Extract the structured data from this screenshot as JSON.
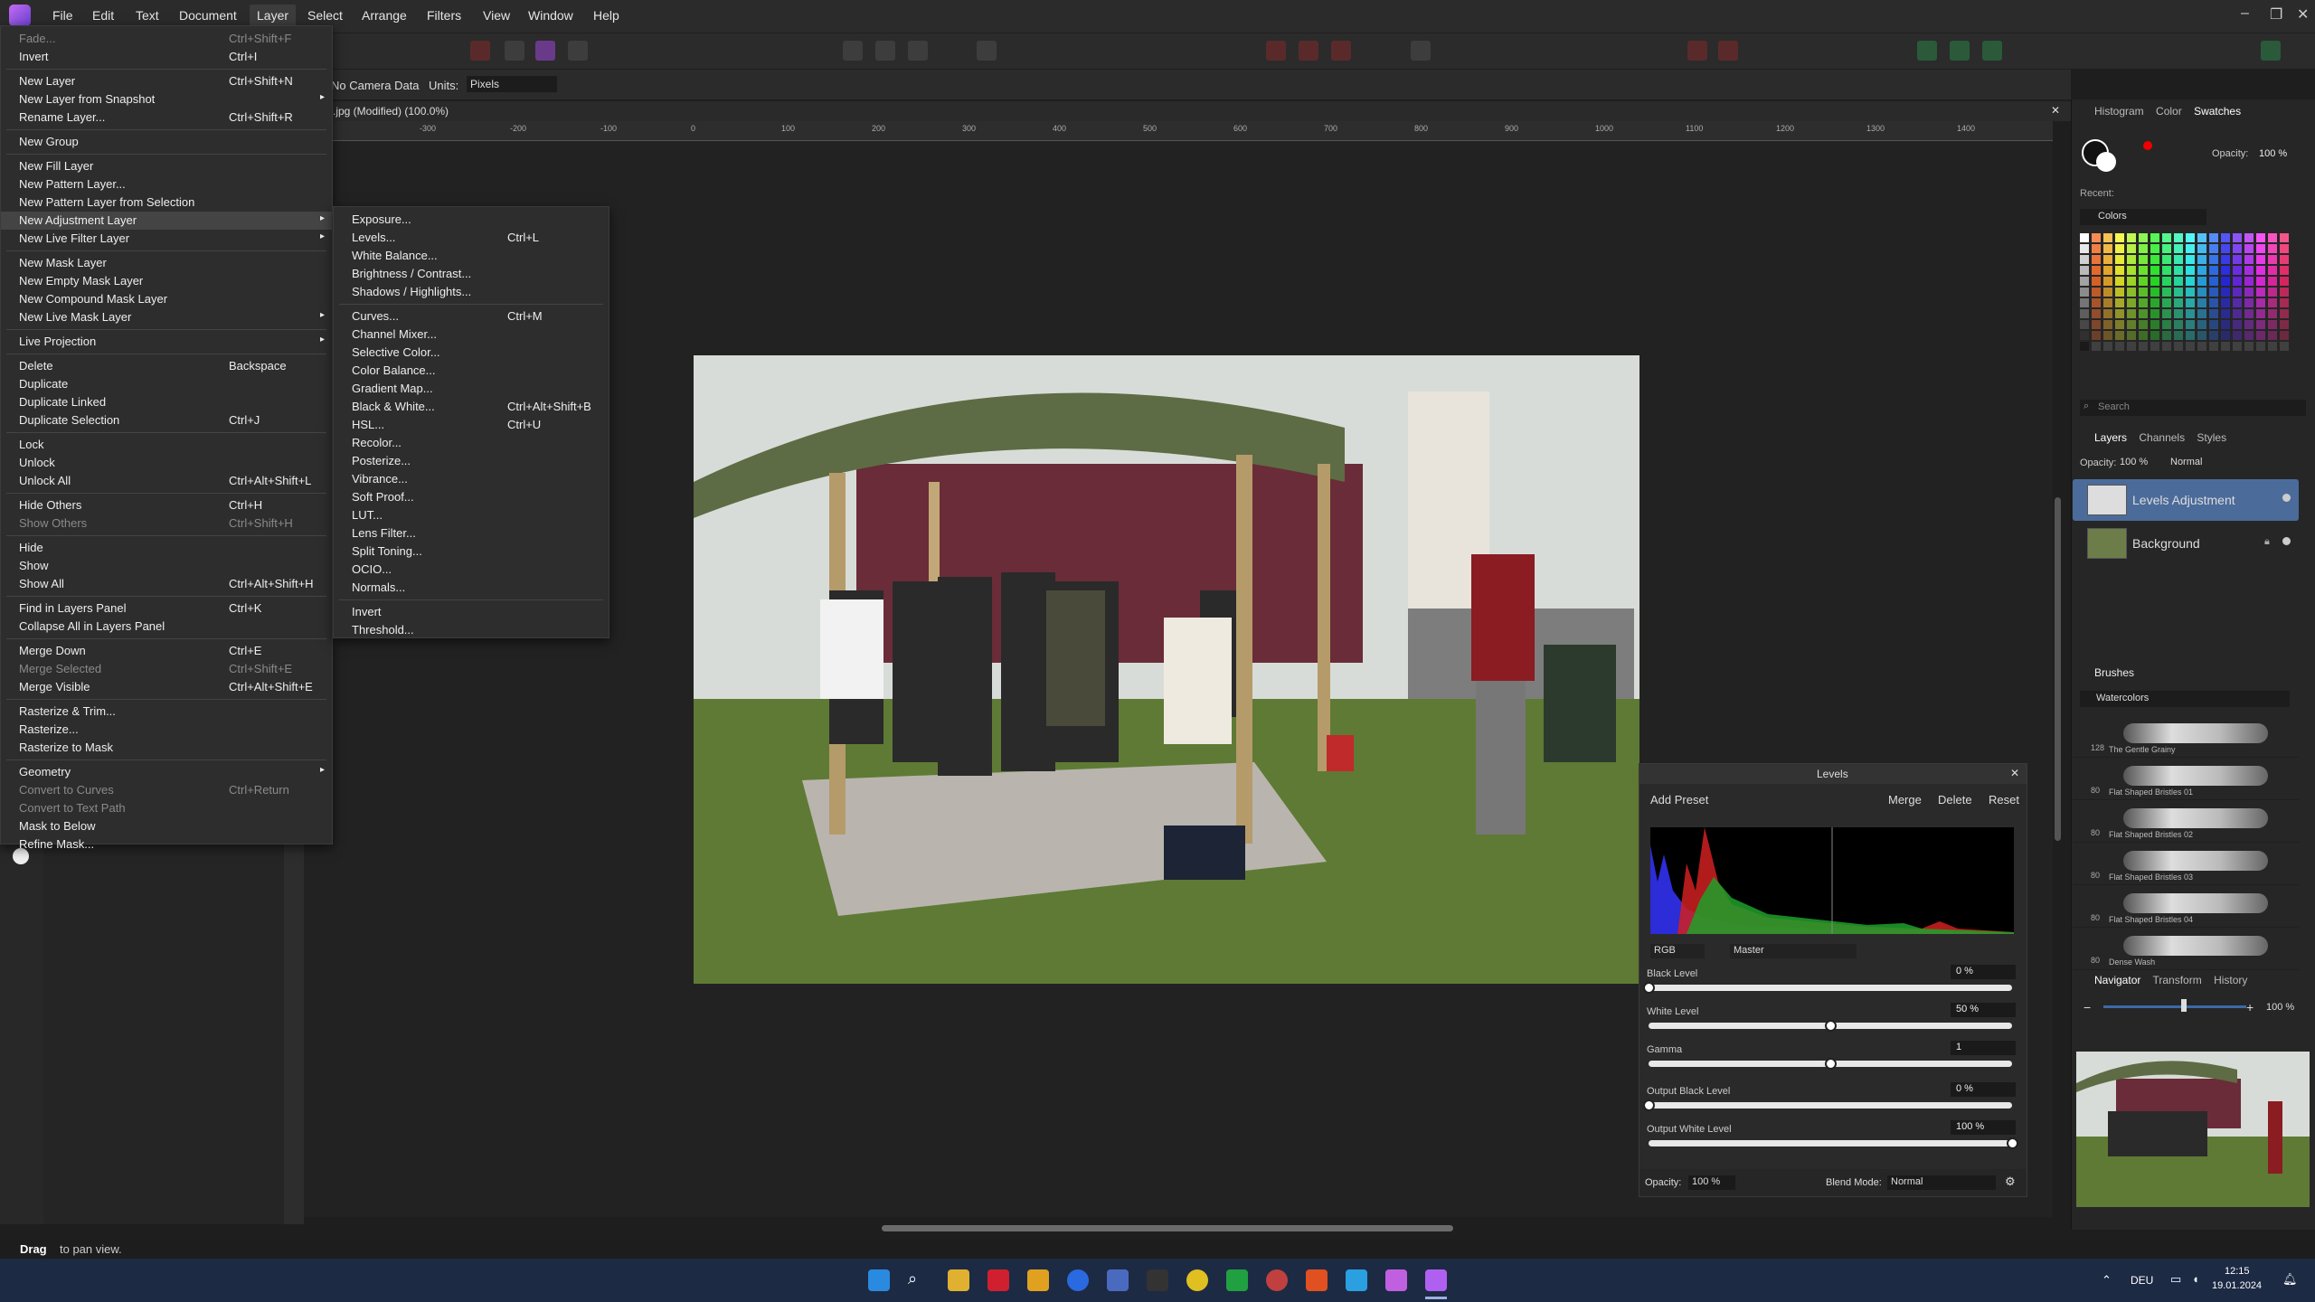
{
  "menubar": {
    "items": [
      "File",
      "Edit",
      "Text",
      "Document",
      "Layer",
      "Select",
      "Arrange",
      "Filters",
      "View",
      "Window",
      "Help"
    ]
  },
  "context_bar": {
    "camera": "No Camera Data",
    "units_label": "Units:",
    "units_value": "Pixels"
  },
  "document_tab": {
    "title": ".jpg (Modified) (100.0%)"
  },
  "ruler_h": [
    "-300",
    "-200",
    "-100",
    "0",
    "100",
    "200",
    "300",
    "400",
    "500",
    "600",
    "700",
    "800",
    "900",
    "1000",
    "1100",
    "1200",
    "1300",
    "1400"
  ],
  "layer_menu": [
    {
      "label": "Fade...",
      "shortcut": "Ctrl+Shift+F",
      "disabled": true
    },
    {
      "label": "Invert",
      "shortcut": "Ctrl+I"
    },
    {
      "sep": true
    },
    {
      "label": "New Layer",
      "shortcut": "Ctrl+Shift+N"
    },
    {
      "label": "New Layer from Snapshot",
      "sub": true
    },
    {
      "label": "Rename Layer...",
      "shortcut": "Ctrl+Shift+R"
    },
    {
      "sep": true
    },
    {
      "label": "New Group"
    },
    {
      "sep": true
    },
    {
      "label": "New Fill Layer"
    },
    {
      "label": "New Pattern Layer..."
    },
    {
      "label": "New Pattern Layer from Selection"
    },
    {
      "label": "New Adjustment Layer",
      "sub": true,
      "highlight": true
    },
    {
      "label": "New Live Filter Layer",
      "sub": true
    },
    {
      "sep": true
    },
    {
      "label": "New Mask Layer"
    },
    {
      "label": "New Empty Mask Layer"
    },
    {
      "label": "New Compound Mask Layer"
    },
    {
      "label": "New Live Mask Layer",
      "sub": true
    },
    {
      "sep": true
    },
    {
      "label": "Live Projection",
      "sub": true
    },
    {
      "sep": true
    },
    {
      "label": "Delete",
      "shortcut": "Backspace"
    },
    {
      "label": "Duplicate"
    },
    {
      "label": "Duplicate Linked"
    },
    {
      "label": "Duplicate Selection",
      "shortcut": "Ctrl+J"
    },
    {
      "sep": true
    },
    {
      "label": "Lock"
    },
    {
      "label": "Unlock"
    },
    {
      "label": "Unlock All",
      "shortcut": "Ctrl+Alt+Shift+L"
    },
    {
      "sep": true
    },
    {
      "label": "Hide Others",
      "shortcut": "Ctrl+H"
    },
    {
      "label": "Show Others",
      "shortcut": "Ctrl+Shift+H",
      "disabled": true
    },
    {
      "sep": true
    },
    {
      "label": "Hide"
    },
    {
      "label": "Show"
    },
    {
      "label": "Show All",
      "shortcut": "Ctrl+Alt+Shift+H"
    },
    {
      "sep": true
    },
    {
      "label": "Find in Layers Panel",
      "shortcut": "Ctrl+K"
    },
    {
      "label": "Collapse All in Layers Panel"
    },
    {
      "sep": true
    },
    {
      "label": "Merge Down",
      "shortcut": "Ctrl+E"
    },
    {
      "label": "Merge Selected",
      "shortcut": "Ctrl+Shift+E",
      "disabled": true
    },
    {
      "label": "Merge Visible",
      "shortcut": "Ctrl+Alt+Shift+E"
    },
    {
      "sep": true
    },
    {
      "label": "Rasterize & Trim..."
    },
    {
      "label": "Rasterize..."
    },
    {
      "label": "Rasterize to Mask"
    },
    {
      "sep": true
    },
    {
      "label": "Geometry",
      "sub": true
    },
    {
      "label": "Convert to Curves",
      "shortcut": "Ctrl+Return",
      "disabled": true
    },
    {
      "label": "Convert to Text Path",
      "disabled": true
    },
    {
      "label": "Mask to Below"
    },
    {
      "label": "Refine Mask..."
    }
  ],
  "adjust_menu": [
    {
      "label": "Exposure..."
    },
    {
      "label": "Levels...",
      "shortcut": "Ctrl+L"
    },
    {
      "label": "White Balance..."
    },
    {
      "label": "Brightness / Contrast..."
    },
    {
      "label": "Shadows / Highlights..."
    },
    {
      "sep": true
    },
    {
      "label": "Curves...",
      "shortcut": "Ctrl+M"
    },
    {
      "label": "Channel Mixer..."
    },
    {
      "label": "Selective Color..."
    },
    {
      "label": "Color Balance..."
    },
    {
      "label": "Gradient Map..."
    },
    {
      "label": "Black & White...",
      "shortcut": "Ctrl+Alt+Shift+B"
    },
    {
      "label": "HSL...",
      "shortcut": "Ctrl+U"
    },
    {
      "label": "Recolor..."
    },
    {
      "label": "Posterize..."
    },
    {
      "label": "Vibrance..."
    },
    {
      "label": "Soft Proof..."
    },
    {
      "label": "LUT..."
    },
    {
      "label": "Lens Filter..."
    },
    {
      "label": "Split Toning..."
    },
    {
      "label": "OCIO..."
    },
    {
      "label": "Normals..."
    },
    {
      "sep": true
    },
    {
      "label": "Invert"
    },
    {
      "label": "Threshold..."
    }
  ],
  "right_panel": {
    "top_tabs": [
      "Histogram",
      "Color",
      "Swatches"
    ],
    "opacity_label": "Opacity:",
    "opacity_value": "100 %",
    "recent_label": "Recent:",
    "palette": "Colors",
    "search_placeholder": "Search",
    "layer_tabs": [
      "Layers",
      "Channels",
      "Styles"
    ],
    "layer_opacity": "100 %",
    "blend": "Normal",
    "layers": [
      {
        "name": "Levels Adjustment",
        "selected": true
      },
      {
        "name": "Background",
        "locked": true
      }
    ],
    "brushes_title": "Brushes",
    "brush_category": "Watercolors",
    "brushes": [
      {
        "size": "128",
        "name": "The Gentle Grainy"
      },
      {
        "size": "80",
        "name": "Flat Shaped Bristles 01"
      },
      {
        "size": "80",
        "name": "Flat Shaped Bristles 02"
      },
      {
        "size": "80",
        "name": "Flat Shaped Bristles 03"
      },
      {
        "size": "80",
        "name": "Flat Shaped Bristles 04"
      },
      {
        "size": "80",
        "name": "Dense Wash"
      }
    ],
    "nav_tabs": [
      "Navigator",
      "Transform",
      "History"
    ],
    "zoom": "100 %"
  },
  "levels": {
    "title": "Levels",
    "add_preset": "Add Preset",
    "merge": "Merge",
    "delete": "Delete",
    "reset": "Reset",
    "channel": "RGB",
    "mode": "Master",
    "black_label": "Black Level",
    "black_value": "0 %",
    "black_pos": 0,
    "white_label": "White Level",
    "white_value": "50 %",
    "white_pos": 0.5,
    "gamma_label": "Gamma",
    "gamma_value": "1",
    "gamma_pos": 0.5,
    "out_black_label": "Output Black Level",
    "out_black_value": "0 %",
    "out_black_pos": 0,
    "out_white_label": "Output White Level",
    "out_white_value": "100 %",
    "out_white_pos": 1,
    "opacity_label": "Opacity:",
    "opacity_value": "100 %",
    "blend_label": "Blend Mode:",
    "blend_value": "Normal"
  },
  "status": {
    "bold": "Drag",
    "rest": "to pan view."
  },
  "taskbar": {
    "lang": "DEU",
    "time": "12:15",
    "date": "19.01.2024"
  }
}
